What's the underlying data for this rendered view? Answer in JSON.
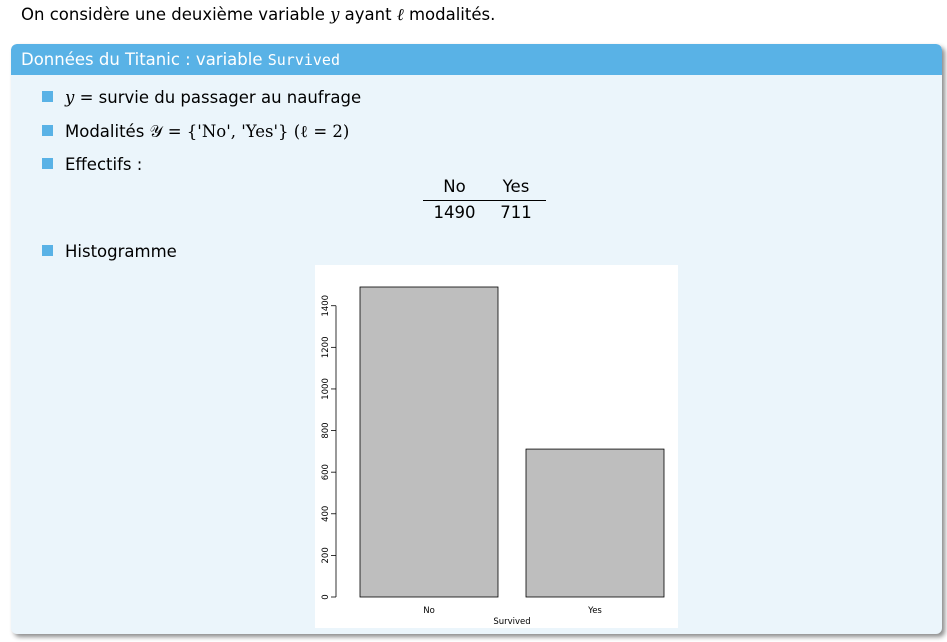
{
  "intro": {
    "prefix": "On considère une deuxième variable ",
    "var_y": "y",
    "middle": " ayant ",
    "var_l": "ℓ",
    "suffix": " modalités."
  },
  "block": {
    "title_text": "Données du Titanic : variable ",
    "title_code": "Survived",
    "items": [
      {
        "math": "y",
        "eq": " = ",
        "text": "survie du passager au naufrage"
      },
      {
        "text": "Modalités ",
        "math": "𝒴 = {'No', 'Yes'} (ℓ = 2)"
      },
      {
        "text": "Effectifs :"
      },
      {
        "text": "Histogramme"
      }
    ],
    "effectifs": {
      "headers": [
        "No",
        "Yes"
      ],
      "values": [
        "1490",
        "711"
      ]
    }
  },
  "chart_data": {
    "type": "bar",
    "categories": [
      "No",
      "Yes"
    ],
    "values": [
      1490,
      711
    ],
    "xlabel": "Survived",
    "ylabel": "",
    "ylim": [
      0,
      1490
    ],
    "yticks": [
      "0",
      "200",
      "400",
      "600",
      "800",
      "1000",
      "1200",
      "1400"
    ],
    "bar_color": "#bebebe",
    "grid": false
  },
  "colors": {
    "accent": "#59b2e6",
    "block_bg": "#ebf5fb"
  }
}
